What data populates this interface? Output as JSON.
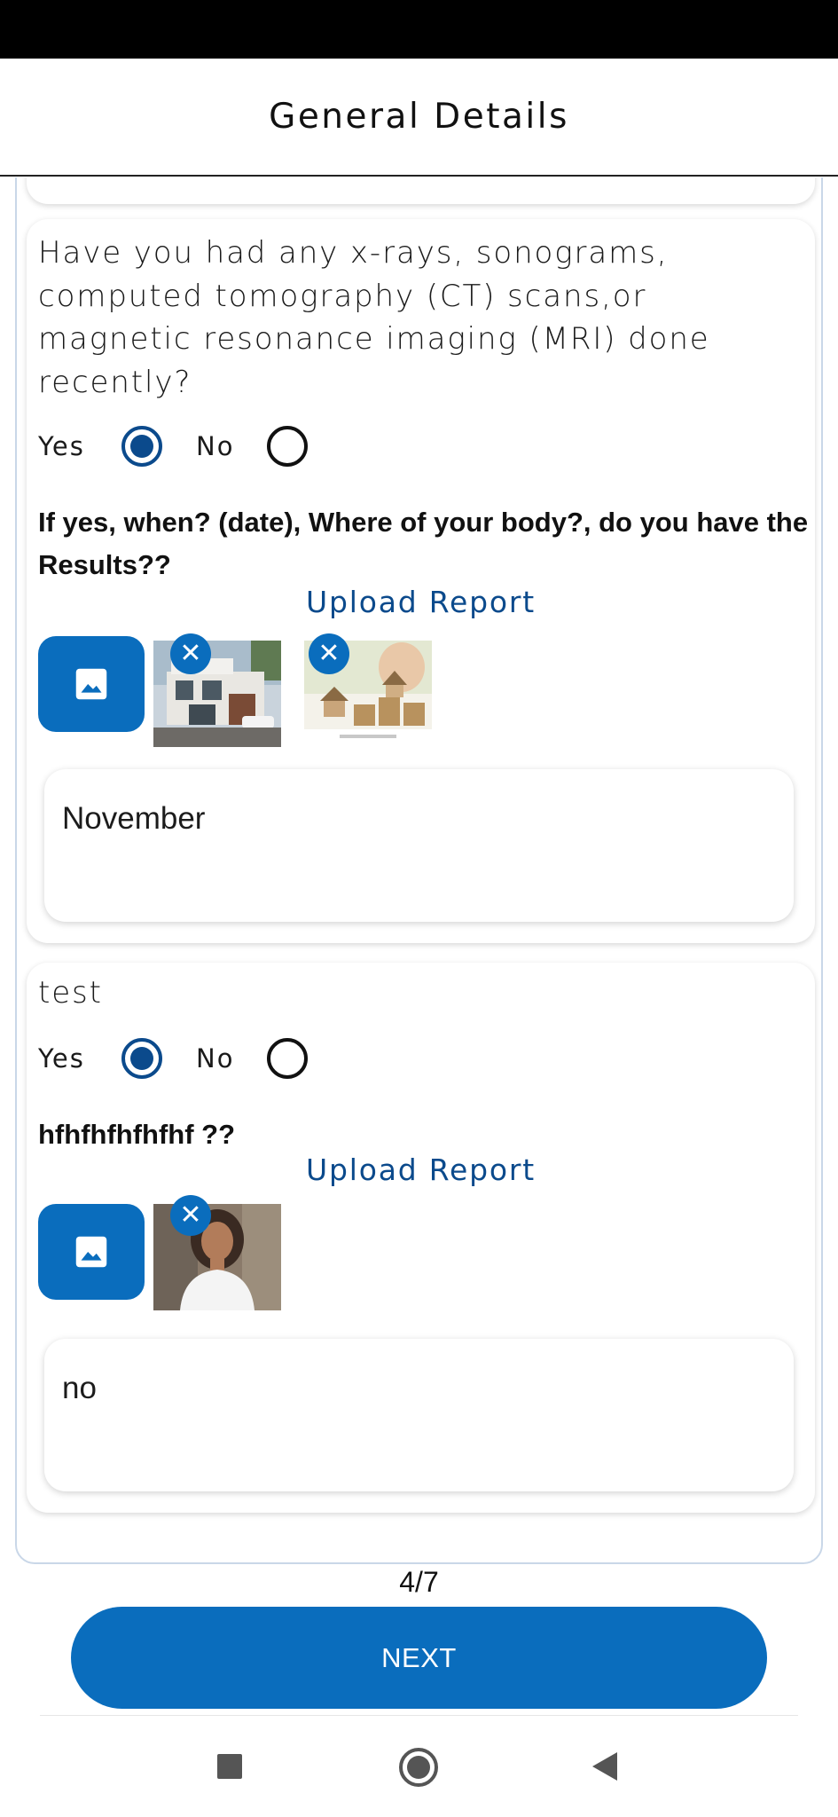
{
  "header": {
    "title": "General Details"
  },
  "questions": [
    {
      "text": "Have you had any x-rays, sonograms, computed tomography (CT) scans,or magnetic resonance imaging (MRI) done recently?",
      "yes_label": "Yes",
      "no_label": "No",
      "selected": "Yes",
      "followup": "If yes, when? (date), Where of your body?, do you have the Results??",
      "upload_label": "Upload Report",
      "attachments": [
        "house-photo",
        "coins-house-photo"
      ],
      "answer": "November"
    },
    {
      "text": "test",
      "yes_label": "Yes",
      "no_label": "No",
      "selected": "Yes",
      "followup": "hfhfhfhfhfhf ??",
      "upload_label": "Upload Report",
      "attachments": [
        "portrait-photo"
      ],
      "answer": "no"
    }
  ],
  "pager": {
    "text": "4/7"
  },
  "next_button": {
    "label": "NEXT"
  },
  "colors": {
    "primary": "#0a6dbd",
    "radio_selected": "#0b4a8c",
    "link": "#0b4a8c"
  },
  "icons": {
    "upload": "image-icon",
    "remove": "close-icon",
    "nav": [
      "recents-square-icon",
      "home-circle-icon",
      "back-triangle-icon"
    ]
  }
}
